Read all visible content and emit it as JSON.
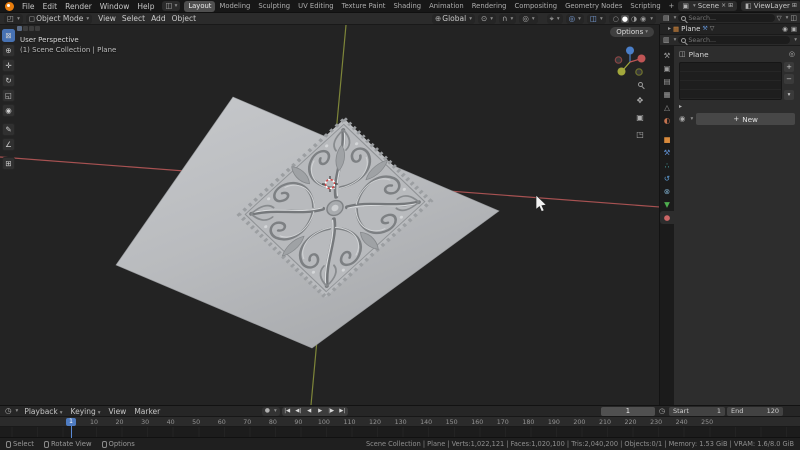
{
  "topbar": {
    "menus": [
      {
        "label": "File"
      },
      {
        "label": "Edit"
      },
      {
        "label": "Render"
      },
      {
        "label": "Window"
      },
      {
        "label": "Help"
      }
    ],
    "workspaces": [
      {
        "label": "Layout",
        "active": true
      },
      {
        "label": "Modeling"
      },
      {
        "label": "Sculpting"
      },
      {
        "label": "UV Editing"
      },
      {
        "label": "Texture Paint"
      },
      {
        "label": "Shading"
      },
      {
        "label": "Animation"
      },
      {
        "label": "Rendering"
      },
      {
        "label": "Compositing"
      },
      {
        "label": "Geometry Nodes"
      },
      {
        "label": "Scripting"
      },
      {
        "label": "+"
      }
    ],
    "scene_label": "Scene",
    "view_layer_label": "ViewLayer"
  },
  "viewport": {
    "header": {
      "mode": "Object Mode",
      "menus": [
        {
          "label": "View"
        },
        {
          "label": "Select"
        },
        {
          "label": "Add"
        },
        {
          "label": "Object"
        }
      ],
      "orientation": "Global"
    },
    "overlay": {
      "view_label": "User Perspective",
      "context_label": "(1) Scene Collection | Plane"
    },
    "options_button": "Options",
    "toolbar": [
      {
        "name": "select-box-tool",
        "glyph": "⊠",
        "active": true
      },
      {
        "name": "cursor-tool",
        "glyph": "⊕"
      },
      {
        "name": "move-tool",
        "glyph": "✛"
      },
      {
        "name": "rotate-tool",
        "glyph": "↻"
      },
      {
        "name": "scale-tool",
        "glyph": "◱"
      },
      {
        "name": "transform-tool",
        "glyph": "◉"
      },
      {
        "name": "annotate-tool",
        "glyph": "✎"
      },
      {
        "name": "measure-tool",
        "glyph": "∠"
      },
      {
        "name": "add-cube-tool",
        "glyph": "⊞"
      }
    ]
  },
  "outliner": {
    "search_placeholder": "Search...",
    "item_label": "Plane"
  },
  "properties": {
    "search_placeholder": "Search...",
    "breadcrumb": "Plane",
    "new_button": "New",
    "tabs": [
      {
        "name": "tab-tool",
        "glyph": "⚒",
        "color": "#9c9c9c"
      },
      {
        "name": "tab-render",
        "glyph": "▣",
        "color": "#9c9c9c"
      },
      {
        "name": "tab-output",
        "glyph": "▤",
        "color": "#9c9c9c"
      },
      {
        "name": "tab-view-layer",
        "glyph": "▦",
        "color": "#9c9c9c"
      },
      {
        "name": "tab-scene",
        "glyph": "△",
        "color": "#9c9c9c"
      },
      {
        "name": "tab-world",
        "glyph": "◐",
        "color": "#c4724f"
      },
      {
        "name": "tab-object",
        "glyph": "■",
        "color": "#d98a3c"
      },
      {
        "name": "tab-modifiers",
        "glyph": "⚒",
        "color": "#5f8fd0"
      },
      {
        "name": "tab-particles",
        "glyph": "∴",
        "color": "#4fb8b8"
      },
      {
        "name": "tab-physics",
        "glyph": "↺",
        "color": "#5f9fd8"
      },
      {
        "name": "tab-constraints",
        "glyph": "⊗",
        "color": "#7fb0d0"
      },
      {
        "name": "tab-object-data",
        "glyph": "▼",
        "color": "#4fae4f"
      },
      {
        "name": "tab-material",
        "glyph": "●",
        "color": "#cc6666",
        "active": true
      }
    ]
  },
  "timeline": {
    "menus": [
      {
        "label": "Playback",
        "caret": true
      },
      {
        "label": "Keying",
        "caret": true
      },
      {
        "label": "View"
      },
      {
        "label": "Marker"
      }
    ],
    "playback": [
      {
        "name": "jump-to-start-button",
        "glyph": "|◀"
      },
      {
        "name": "previous-keyframe-button",
        "glyph": "◀|"
      },
      {
        "name": "play-reverse-button",
        "glyph": "◀"
      },
      {
        "name": "play-button",
        "glyph": "▶"
      },
      {
        "name": "next-keyframe-button",
        "glyph": "|▶"
      },
      {
        "name": "jump-to-end-button",
        "glyph": "▶|"
      }
    ],
    "current_frame": "1",
    "start_label": "Start",
    "start_value": "1",
    "end_label": "End",
    "end_value": "120",
    "ruler": [
      "10",
      "20",
      "30",
      "40",
      "50",
      "60",
      "70",
      "80",
      "90",
      "100",
      "110",
      "120",
      "130",
      "140",
      "150",
      "160",
      "170",
      "180",
      "190",
      "200",
      "210",
      "220",
      "230",
      "240",
      "250"
    ]
  },
  "statusbar": {
    "hints": [
      {
        "label": "Select"
      },
      {
        "label": "Rotate View"
      },
      {
        "label": "Options"
      }
    ],
    "stats": "Scene Collection | Plane | Verts:1,022,121 | Faces:1,020,100 | Tris:2,040,200 | Objects:0/1 | Memory: 1.53 GiB | VRAM: 1.6/8.0 GiB"
  },
  "colors": {
    "accent": "#4772b3",
    "axis_x": "#a85252",
    "axis_y": "#7e8639",
    "object_orange": "#d98a3c"
  }
}
